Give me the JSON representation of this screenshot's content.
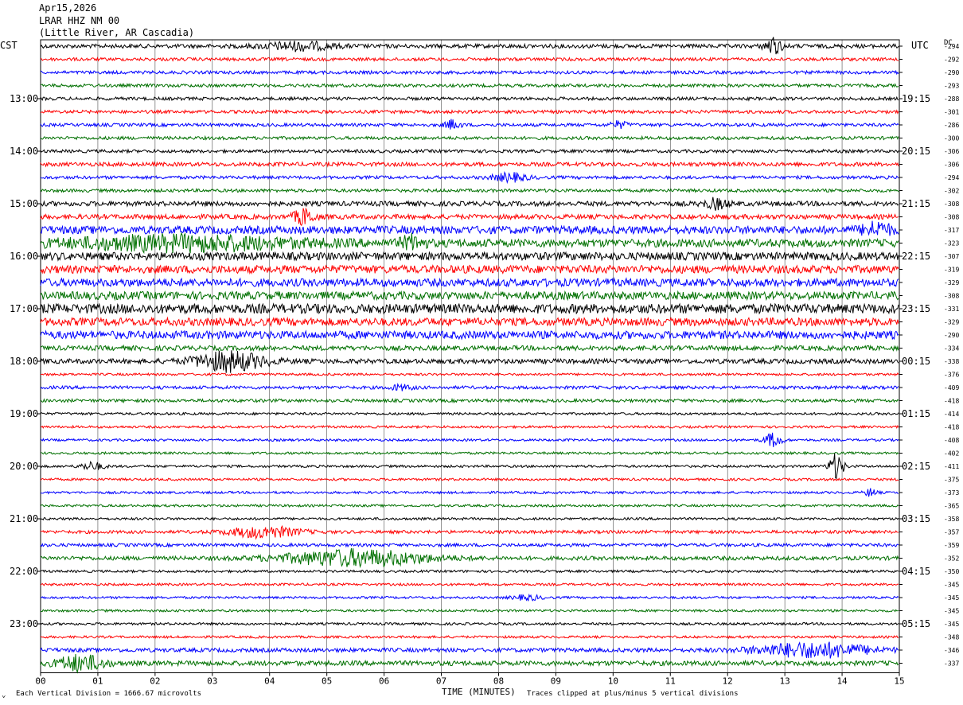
{
  "header": {
    "date": "Apr15,2026",
    "station": "LRAR HHZ NM 00",
    "location": "(Little River, AR Cascadia)"
  },
  "left_tz": "CST",
  "right_tz": "UTC",
  "dc_label": "DC",
  "footer": {
    "division_note": "Each Vertical Division = 1666.67 microvolts",
    "xlabel": "TIME (MINUTES)",
    "clip_note": "Traces clipped at plus/minus 5 vertical divisions"
  },
  "colors": {
    "cycle": [
      "#000000",
      "#ff0000",
      "#0000ff",
      "#007000"
    ],
    "grid": "#000000"
  },
  "chart_data": {
    "type": "line",
    "x_range": [
      0,
      15
    ],
    "x_ticks": [
      "00",
      "01",
      "02",
      "03",
      "04",
      "05",
      "06",
      "07",
      "08",
      "09",
      "10",
      "11",
      "12",
      "13",
      "14",
      "15"
    ],
    "trace_count": 48,
    "left_hour_labels": [
      {
        "trace": 4,
        "text": "13:00"
      },
      {
        "trace": 8,
        "text": "14:00"
      },
      {
        "trace": 12,
        "text": "15:00"
      },
      {
        "trace": 16,
        "text": "16:00"
      },
      {
        "trace": 20,
        "text": "17:00"
      },
      {
        "trace": 24,
        "text": "18:00"
      },
      {
        "trace": 28,
        "text": "19:00"
      },
      {
        "trace": 32,
        "text": "20:00"
      },
      {
        "trace": 36,
        "text": "21:00"
      },
      {
        "trace": 40,
        "text": "22:00"
      },
      {
        "trace": 44,
        "text": "23:00"
      }
    ],
    "right_hour_labels": [
      {
        "trace": 4,
        "text": "19:15"
      },
      {
        "trace": 8,
        "text": "20:15"
      },
      {
        "trace": 12,
        "text": "21:15"
      },
      {
        "trace": 16,
        "text": "22:15"
      },
      {
        "trace": 20,
        "text": "23:15"
      },
      {
        "trace": 24,
        "text": "00:15"
      },
      {
        "trace": 28,
        "text": "01:15"
      },
      {
        "trace": 32,
        "text": "02:15"
      },
      {
        "trace": 36,
        "text": "03:15"
      },
      {
        "trace": 40,
        "text": "04:15"
      },
      {
        "trace": 44,
        "text": "05:15"
      }
    ],
    "dc_offsets": [
      "-294",
      "-292",
      "-290",
      "-293",
      "-288",
      "-301",
      "-286",
      "-300",
      "-306",
      "-306",
      "-294",
      "-302",
      "-308",
      "-308",
      "-317",
      "-323",
      "-307",
      "-319",
      "-329",
      "-308",
      "-331",
      "-329",
      "-290",
      "-334",
      "-338",
      "-376",
      "-409",
      "-418",
      "-414",
      "-418",
      "-408",
      "-402",
      "-411",
      "-375",
      "-373",
      "-365",
      "-358",
      "-357",
      "-359",
      "-352",
      "-350",
      "-345",
      "-345",
      "-345",
      "-345",
      "-348",
      "-346",
      "-337"
    ],
    "noise_amplitudes": [
      2.5,
      2,
      2,
      2,
      2,
      2,
      2,
      2,
      2,
      2.5,
      2,
      2,
      3,
      3,
      5,
      5,
      5,
      5,
      5,
      5,
      6,
      5,
      5,
      3,
      3,
      1.5,
      2,
      2,
      1.5,
      1.5,
      1.5,
      1.5,
      1.5,
      1.5,
      1.5,
      1.5,
      1.5,
      2,
      2,
      2.5,
      1.5,
      1.5,
      1.5,
      1.5,
      1.5,
      1.5,
      2.5,
      3
    ],
    "events": [
      {
        "trace": 0,
        "minute": 4.5,
        "width": 1.2,
        "amp": 5
      },
      {
        "trace": 0,
        "minute": 12.8,
        "width": 0.3,
        "amp": 10
      },
      {
        "trace": 6,
        "minute": 7.2,
        "width": 0.25,
        "amp": 6
      },
      {
        "trace": 6,
        "minute": 10.1,
        "width": 0.3,
        "amp": 4
      },
      {
        "trace": 10,
        "minute": 8.2,
        "width": 0.6,
        "amp": 5
      },
      {
        "trace": 12,
        "minute": 11.8,
        "width": 0.4,
        "amp": 6
      },
      {
        "trace": 13,
        "minute": 4.6,
        "width": 0.35,
        "amp": 10
      },
      {
        "trace": 15,
        "minute": 2.5,
        "width": 4,
        "amp": 8
      },
      {
        "trace": 15,
        "minute": 6.5,
        "width": 0.4,
        "amp": 8
      },
      {
        "trace": 14,
        "minute": 14.6,
        "width": 0.5,
        "amp": 8
      },
      {
        "trace": 24,
        "minute": 3.3,
        "width": 1.2,
        "amp": 12
      },
      {
        "trace": 26,
        "minute": 6.3,
        "width": 0.4,
        "amp": 3
      },
      {
        "trace": 30,
        "minute": 12.8,
        "width": 0.3,
        "amp": 9
      },
      {
        "trace": 32,
        "minute": 13.9,
        "width": 0.25,
        "amp": 16
      },
      {
        "trace": 32,
        "minute": 0.9,
        "width": 0.4,
        "amp": 5
      },
      {
        "trace": 34,
        "minute": 14.5,
        "width": 0.2,
        "amp": 5
      },
      {
        "trace": 37,
        "minute": 3.9,
        "width": 1.2,
        "amp": 7
      },
      {
        "trace": 39,
        "minute": 5.5,
        "width": 2.5,
        "amp": 10
      },
      {
        "trace": 42,
        "minute": 8.5,
        "width": 0.5,
        "amp": 3
      },
      {
        "trace": 46,
        "minute": 13.5,
        "width": 2,
        "amp": 9
      },
      {
        "trace": 47,
        "minute": 0.7,
        "width": 0.8,
        "amp": 10
      }
    ]
  }
}
